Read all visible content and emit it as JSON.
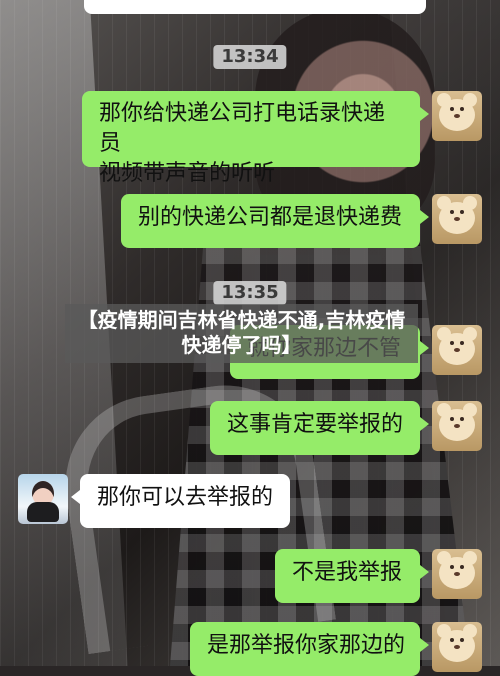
{
  "timestamps": {
    "first": "13:34",
    "second": "13:35"
  },
  "messages": [
    {
      "text": "那你给快递公司打电话录快递员\n视频带声音的听听"
    },
    {
      "text": "别的快递公司都是退快递费"
    },
    {
      "text": "就你家那边不管"
    },
    {
      "text": "这事肯定要举报的"
    },
    {
      "text": "那你可以去举报的"
    },
    {
      "text": "不是我举报"
    },
    {
      "text": "是那举报你家那边的"
    }
  ],
  "caption": {
    "line1": "【疫情期间吉林省快递不通,吉林疫情",
    "line2": "快递停了吗】"
  },
  "avatars": {
    "right_icon": "bear-avatar-icon",
    "left_icon": "girl-avatar-icon"
  },
  "colors": {
    "green_bubble": "#95ec69",
    "white_bubble": "#ffffff",
    "timestamp_bg": "#d2d2d2"
  }
}
